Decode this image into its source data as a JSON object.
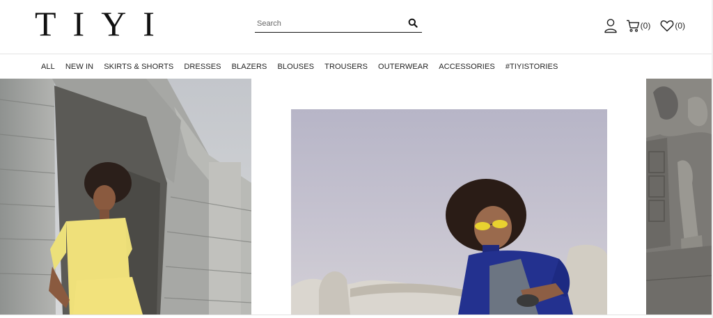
{
  "header": {
    "logo_text": "TIYI",
    "search": {
      "placeholder": "Search",
      "value": ""
    },
    "cart_count": "(0)",
    "wishlist_count": "(0)"
  },
  "nav": {
    "items": [
      {
        "label": "ALL"
      },
      {
        "label": "NEW IN"
      },
      {
        "label": "SKIRTS & SHORTS"
      },
      {
        "label": "DRESSES"
      },
      {
        "label": "BLAZERS"
      },
      {
        "label": "BLOUSES"
      },
      {
        "label": "TROUSERS"
      },
      {
        "label": "OUTERWEAR"
      },
      {
        "label": "ACCESSORIES"
      },
      {
        "label": "#TIYISTORIES"
      }
    ]
  },
  "icons": [
    "search-icon",
    "user-icon",
    "cart-icon",
    "heart-icon"
  ],
  "colors": {
    "text": "#222222",
    "border": "#e3e3e3",
    "background": "#ffffff"
  }
}
